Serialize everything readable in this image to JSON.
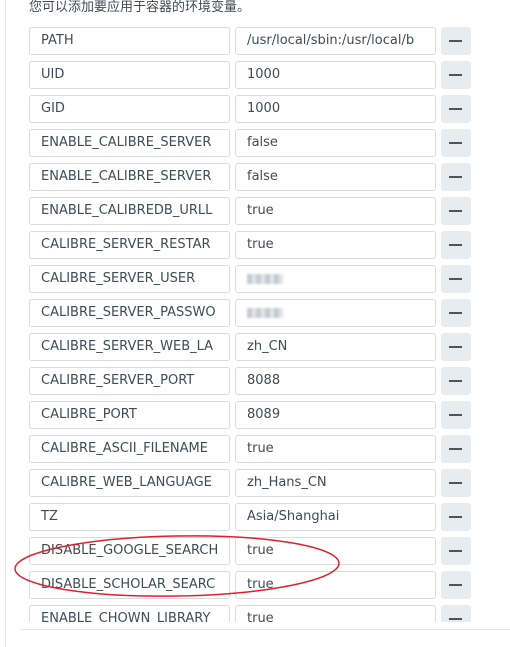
{
  "description": "您可以添加要应用于容器的环境变量。",
  "remove_icon": "minus-icon",
  "annotation_color": "#e0202a",
  "env": [
    {
      "key": "PATH",
      "value": "/usr/local/sbin:/usr/local/b"
    },
    {
      "key": "UID",
      "value": "1000"
    },
    {
      "key": "GID",
      "value": "1000"
    },
    {
      "key": "ENABLE_CALIBRE_SERVER",
      "value": "false"
    },
    {
      "key": "ENABLE_CALIBRE_SERVER",
      "value": "false"
    },
    {
      "key": "ENABLE_CALIBREDB_URLL",
      "value": "true"
    },
    {
      "key": "CALIBRE_SERVER_RESTAR",
      "value": "true"
    },
    {
      "key": "CALIBRE_SERVER_USER",
      "value": null,
      "blurred": true
    },
    {
      "key": "CALIBRE_SERVER_PASSWO",
      "value": null,
      "blurred": true
    },
    {
      "key": "CALIBRE_SERVER_WEB_LA",
      "value": "zh_CN"
    },
    {
      "key": "CALIBRE_SERVER_PORT",
      "value": "8088"
    },
    {
      "key": "CALIBRE_PORT",
      "value": "8089"
    },
    {
      "key": "CALIBRE_ASCII_FILENAME",
      "value": "true"
    },
    {
      "key": "CALIBRE_WEB_LANGUAGE",
      "value": "zh_Hans_CN"
    },
    {
      "key": "TZ",
      "value": "Asia/Shanghai"
    },
    {
      "key": "DISABLE_GOOGLE_SEARCH",
      "value": "true"
    },
    {
      "key": "DISABLE_SCHOLAR_SEARC",
      "value": "true"
    },
    {
      "key": "ENABLE_CHOWN_LIBRARY",
      "value": "true"
    }
  ]
}
